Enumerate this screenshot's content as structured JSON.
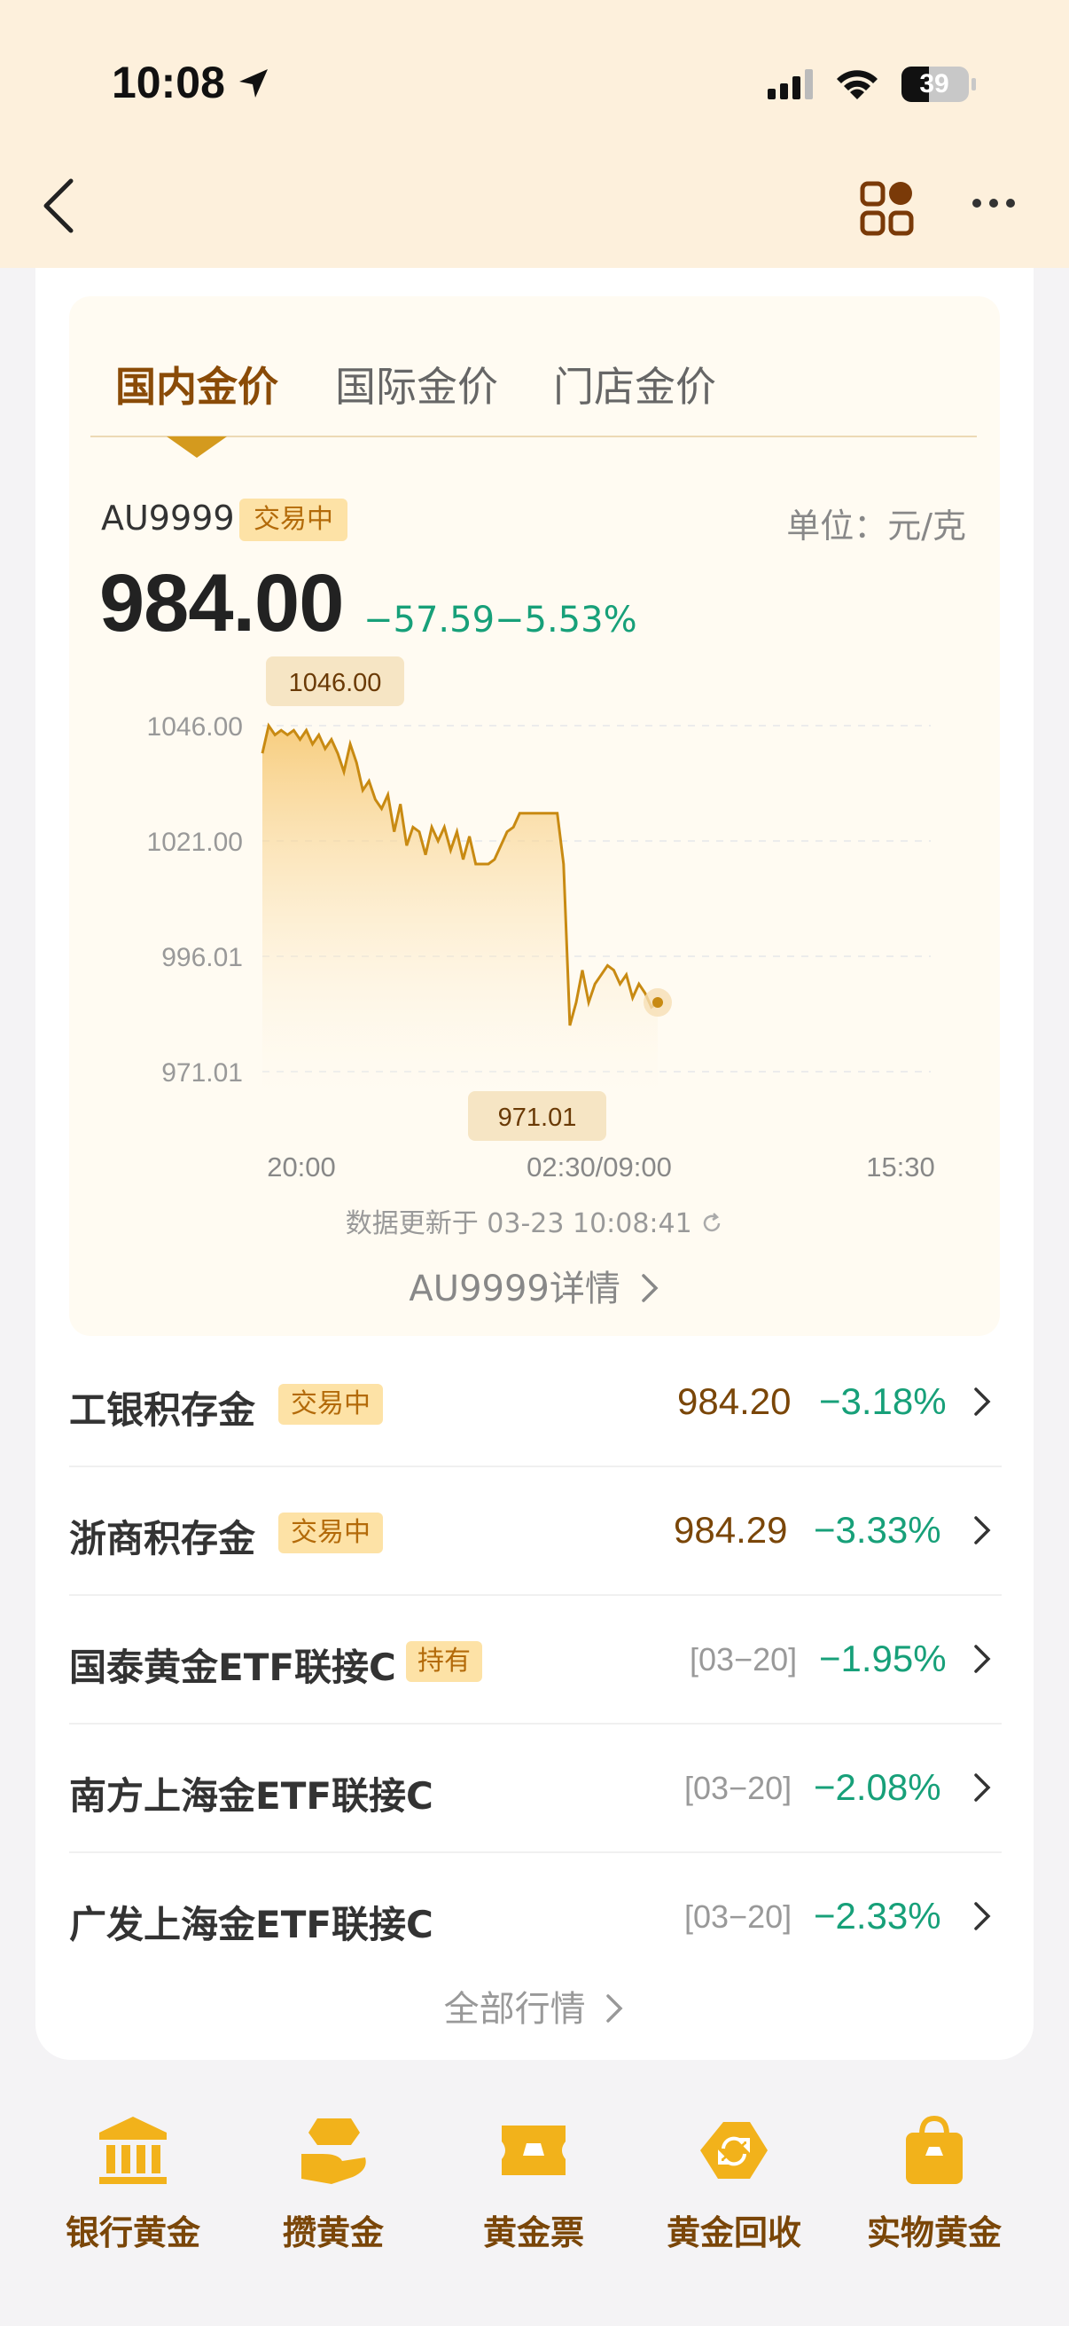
{
  "status_bar": {
    "time": "10:08",
    "battery": "39"
  },
  "tabs": [
    {
      "label": "国内金价",
      "active": true
    },
    {
      "label": "国际金价",
      "active": false
    },
    {
      "label": "门店金价",
      "active": false
    }
  ],
  "quote": {
    "symbol": "AU9999",
    "badge": "交易中",
    "unit": "单位：元/克",
    "price": "984.00",
    "change": "−57.59",
    "change_pct": "−5.53%"
  },
  "chart_data": {
    "type": "area",
    "y_ticks": [
      "1046.00",
      "1021.00",
      "996.01",
      "971.01"
    ],
    "x_ticks": [
      "20:00",
      "02:30/09:00",
      "15:30"
    ],
    "high_label": "1046.00",
    "low_label": "971.01",
    "ylim": [
      971.01,
      1046.0
    ],
    "series": [
      {
        "values": [
          1040,
          1046,
          1044,
          1045,
          1044,
          1045,
          1043,
          1045,
          1042,
          1044,
          1041,
          1043,
          1040,
          1036,
          1042,
          1038,
          1032,
          1034,
          1030,
          1028,
          1031,
          1023,
          1029,
          1020,
          1024,
          1023,
          1018,
          1024,
          1021,
          1024,
          1019,
          1023,
          1017,
          1022,
          1016,
          1016,
          1016,
          1017,
          1020,
          1023,
          1024,
          1027,
          1027,
          1027,
          1027,
          1027,
          1027,
          1027,
          1016,
          981,
          986,
          993,
          986,
          990,
          992,
          994,
          993,
          990,
          992,
          987,
          990,
          988,
          985,
          986
        ],
        "color": "#d49a1e"
      }
    ],
    "grid": true
  },
  "updated_text": "数据更新于 03-23 10:08:41",
  "detail_link": "AU9999详情",
  "products": [
    {
      "name": "工银积存金",
      "badge": "交易中",
      "price": "984.20",
      "date": "",
      "pct": "−3.18%"
    },
    {
      "name": "浙商积存金",
      "badge": "交易中",
      "price": "984.29",
      "date": "",
      "pct": "−3.33%"
    },
    {
      "name": "国泰黄金ETF联接C",
      "badge": "持有",
      "price": "",
      "date": "[03−20]",
      "pct": "−1.95%"
    },
    {
      "name": "南方上海金ETF联接C",
      "badge": "",
      "price": "",
      "date": "[03−20]",
      "pct": "−2.08%"
    },
    {
      "name": "广发上海金ETF联接C",
      "badge": "",
      "price": "",
      "date": "[03−20]",
      "pct": "−2.33%"
    }
  ],
  "all_quotes": "全部行情",
  "bottom_nav": [
    {
      "label": "银行黄金",
      "icon": "bank-icon"
    },
    {
      "label": "攒黄金",
      "icon": "hand-gold-icon"
    },
    {
      "label": "黄金票",
      "icon": "ticket-icon"
    },
    {
      "label": "黄金回收",
      "icon": "recycle-icon"
    },
    {
      "label": "实物黄金",
      "icon": "shopping-bag-icon"
    }
  ],
  "colors": {
    "accent": "#d49a1e",
    "down": "#17a079",
    "brand_dark": "#7a4608"
  }
}
